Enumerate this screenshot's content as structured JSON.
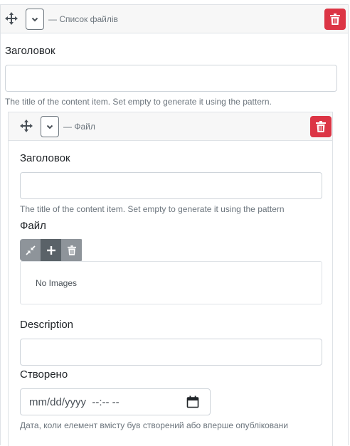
{
  "outer_part": {
    "header_title": "— Список файлів",
    "title_label": "Заголовок",
    "title_value": "",
    "title_hint": "The title of the content item. Set empty to generate it using the pattern."
  },
  "inner_part": {
    "header_title": "— Файл",
    "title_label": "Заголовок",
    "title_value": "",
    "title_hint": "The title of the content item. Set empty to generate it using the pattern",
    "file_label": "Файл",
    "media_empty_text": "No Images",
    "description_label": "Description",
    "description_value": "",
    "created_label": "Створено",
    "created_value": "mm/dd/yyyy  --:-- --",
    "created_hint": "Дата, коли елемент вмісту був створений або вперше опубліковани"
  },
  "colors": {
    "danger": "#dc3545",
    "toolbar_light": "#8e949a",
    "toolbar_dark": "#5a6268",
    "muted_text": "#6c757d",
    "border": "#dee2e6"
  },
  "icons": {
    "move": "move-icon",
    "collapse": "chevron-down-icon",
    "delete": "trash-icon",
    "calendar": "calendar-icon"
  }
}
